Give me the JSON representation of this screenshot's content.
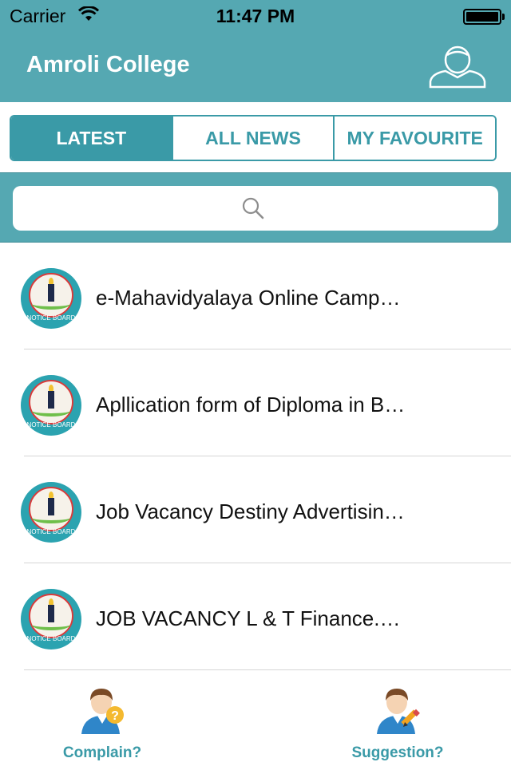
{
  "status": {
    "carrier": "Carrier",
    "time": "11:47 PM",
    "battery_level": 1.0
  },
  "nav": {
    "title": "Amroli College",
    "profile_icon": "user-outline-icon"
  },
  "segments": [
    {
      "label": "LATEST",
      "active": true
    },
    {
      "label": "ALL NEWS",
      "active": false
    },
    {
      "label": "MY FAVOURITE",
      "active": false
    }
  ],
  "search": {
    "icon": "search-icon"
  },
  "news": [
    {
      "title": "e-Mahavidyalaya Online Camp…",
      "thumb_label": "NOTICE BOARD"
    },
    {
      "title": "Apllication form of Diploma in B…",
      "thumb_label": "NOTICE BOARD"
    },
    {
      "title": "Job Vacancy Destiny Advertisin…",
      "thumb_label": "NOTICE BOARD"
    },
    {
      "title": "JOB VACANCY L & T Finance.…",
      "thumb_label": "NOTICE BOARD"
    }
  ],
  "bottom_tabs": {
    "complain": {
      "label": "Complain?",
      "icon": "person-question-icon"
    },
    "suggestion": {
      "label": "Suggestion?",
      "icon": "person-pencil-icon"
    }
  },
  "colors": {
    "accent": "#55a8b2",
    "segment": "#3a9aa7",
    "text": "#111111"
  }
}
